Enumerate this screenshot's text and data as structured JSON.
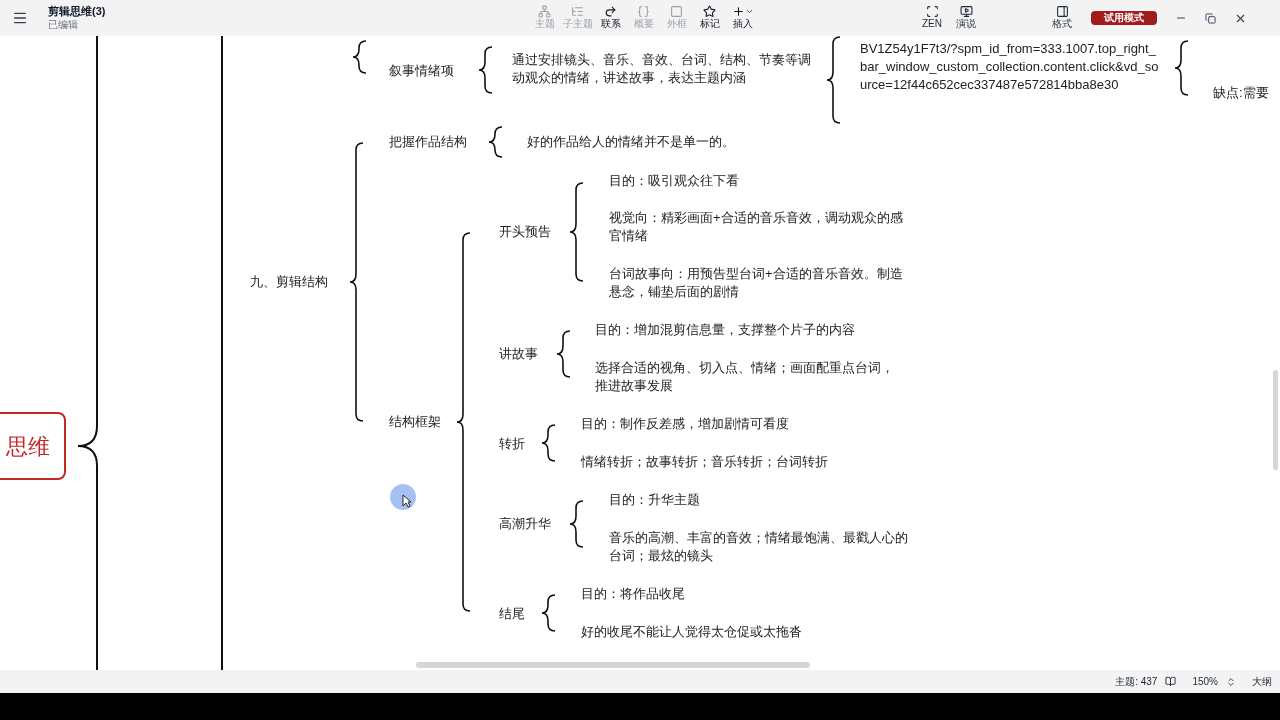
{
  "app": {
    "title": "剪辑思维(3)",
    "subtitle": "已编辑"
  },
  "toolbar": [
    {
      "label": "主题",
      "disabled": true
    },
    {
      "label": "子主题",
      "disabled": true
    },
    {
      "label": "联系",
      "disabled": false
    },
    {
      "label": "概要",
      "disabled": true
    },
    {
      "label": "外框",
      "disabled": true
    },
    {
      "label": "标记",
      "disabled": false
    },
    {
      "label": "插入",
      "disabled": false
    }
  ],
  "view_tools": [
    "ZEN",
    "演说"
  ],
  "format_label": "格式",
  "trial_button": "试用模式",
  "map": {
    "central": "思维",
    "nodes": [
      {
        "text": "叙事情绪项"
      },
      {
        "text": "通过安排镜头、音乐、音效、台词、结构、节奏等调动观众的情绪，讲述故事，表达主题内涵"
      },
      {
        "text": "BV1Z54y1F7t3/?spm_id_from=333.1007.top_right_bar_window_custom_collection.content.click&vd_source=12f44c652cec337487e572814bba8e30"
      },
      {
        "text": "缺点:需要"
      },
      {
        "text": "把握作品结构"
      },
      {
        "text": "好的作品给人的情绪并不是单一的。"
      },
      {
        "text": "九、剪辑结构"
      },
      {
        "text": "结构框架"
      },
      {
        "text": "开头预告"
      },
      {
        "text": "目的：吸引观众往下看"
      },
      {
        "text": "视觉向：精彩画面+合适的音乐音效，调动观众的感官情绪"
      },
      {
        "text": "台词故事向：用预告型台词+合适的音乐音效。制造悬念，铺垫后面的剧情"
      },
      {
        "text": "讲故事"
      },
      {
        "text": "目的：增加混剪信息量，支撑整个片子的内容"
      },
      {
        "text": "选择合适的视角、切入点、情绪；画面配重点台词，推进故事发展"
      },
      {
        "text": "转折"
      },
      {
        "text": "目的：制作反差感，增加剧情可看度"
      },
      {
        "text": "情绪转折；故事转折；音乐转折；台词转折"
      },
      {
        "text": "高潮升华"
      },
      {
        "text": "目的：升华主题"
      },
      {
        "text": "音乐的高潮、丰富的音效；情绪最饱满、最戳人心的台词；最炫的镜头"
      },
      {
        "text": "结尾"
      },
      {
        "text": "目的：将作品收尾"
      },
      {
        "text": "好的收尾不能让人觉得太仓促或太拖沓"
      }
    ]
  },
  "status_bar": {
    "topic_count": "主题: 437",
    "zoom": "150%",
    "outline": "大纲"
  }
}
